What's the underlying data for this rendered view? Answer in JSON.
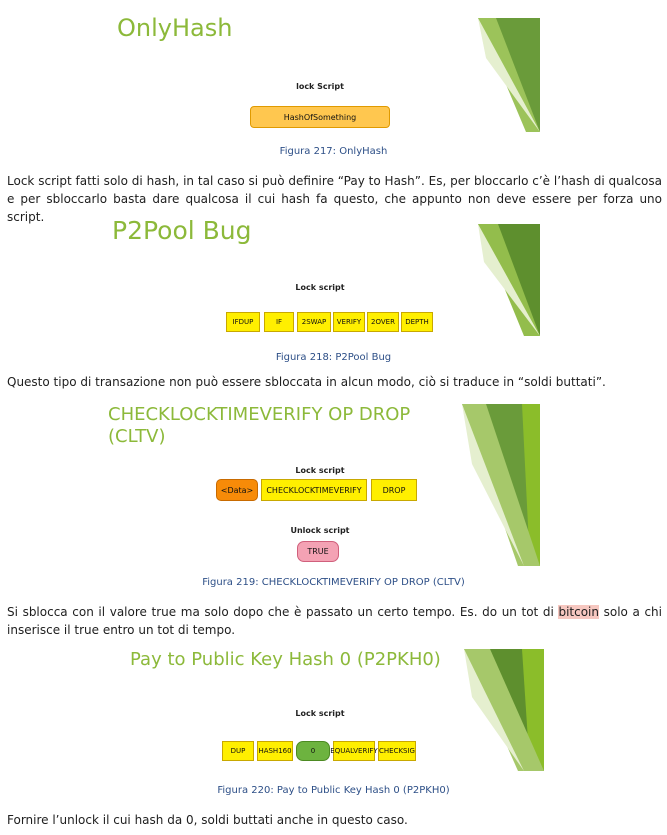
{
  "figures": [
    {
      "title": "OnlyHash",
      "lock_label": "lock Script",
      "ops": [
        "HashOfSomething"
      ],
      "caption": "Figura 217: OnlyHash"
    },
    {
      "title": "P2Pool Bug",
      "lock_label": "Lock script",
      "ops": [
        "IFDUP",
        "IF",
        "2SWAP",
        "VERIFY",
        "2OVER",
        "DEPTH"
      ],
      "caption": "Figura 218: P2Pool Bug"
    },
    {
      "title_line1": "CHECKLOCKTIMEVERIFY OP DROP",
      "title_line2": "(CLTV)",
      "lock_label": "Lock script",
      "ops": [
        "<Data>",
        "CHECKLOCKTIMEVERIFY",
        "DROP"
      ],
      "unlock_label": "Unlock script",
      "unlock_ops": [
        "TRUE"
      ],
      "caption": "Figura 219: CHECKLOCKTIMEVERIFY OP DROP (CLTV)"
    },
    {
      "title": "Pay to Public Key Hash 0  (P2PKH0)",
      "lock_label": "Lock script",
      "ops": [
        "DUP",
        "HASH160",
        "0",
        "EQUALVERIFY",
        "CHECKSIG"
      ],
      "caption": "Figura 220: Pay to Public Key Hash 0 (P2PKH0)"
    }
  ],
  "paragraphs": {
    "p1": "Lock script fatti solo di hash, in tal caso si può definire “Pay to Hash”. Es, per bloccarlo c’è l’hash di qualcosa e per sbloccarlo basta dare qualcosa il cui hash fa questo, che appunto non deve essere per forza uno script.",
    "p2": "Questo tipo di transazione non può essere sbloccata in alcun modo, ciò si traduce in “soldi buttati”.",
    "p3_before": "Si sblocca con il valore true ma solo dopo che è passato un certo tempo. Es. do un tot di ",
    "p3_highlight": "bitcoin",
    "p3_after": " solo a chi inserisce il true entro un tot di tempo.",
    "p4": "Fornire l’unlock il cui hash da 0, soldi buttati anche in questo caso."
  }
}
